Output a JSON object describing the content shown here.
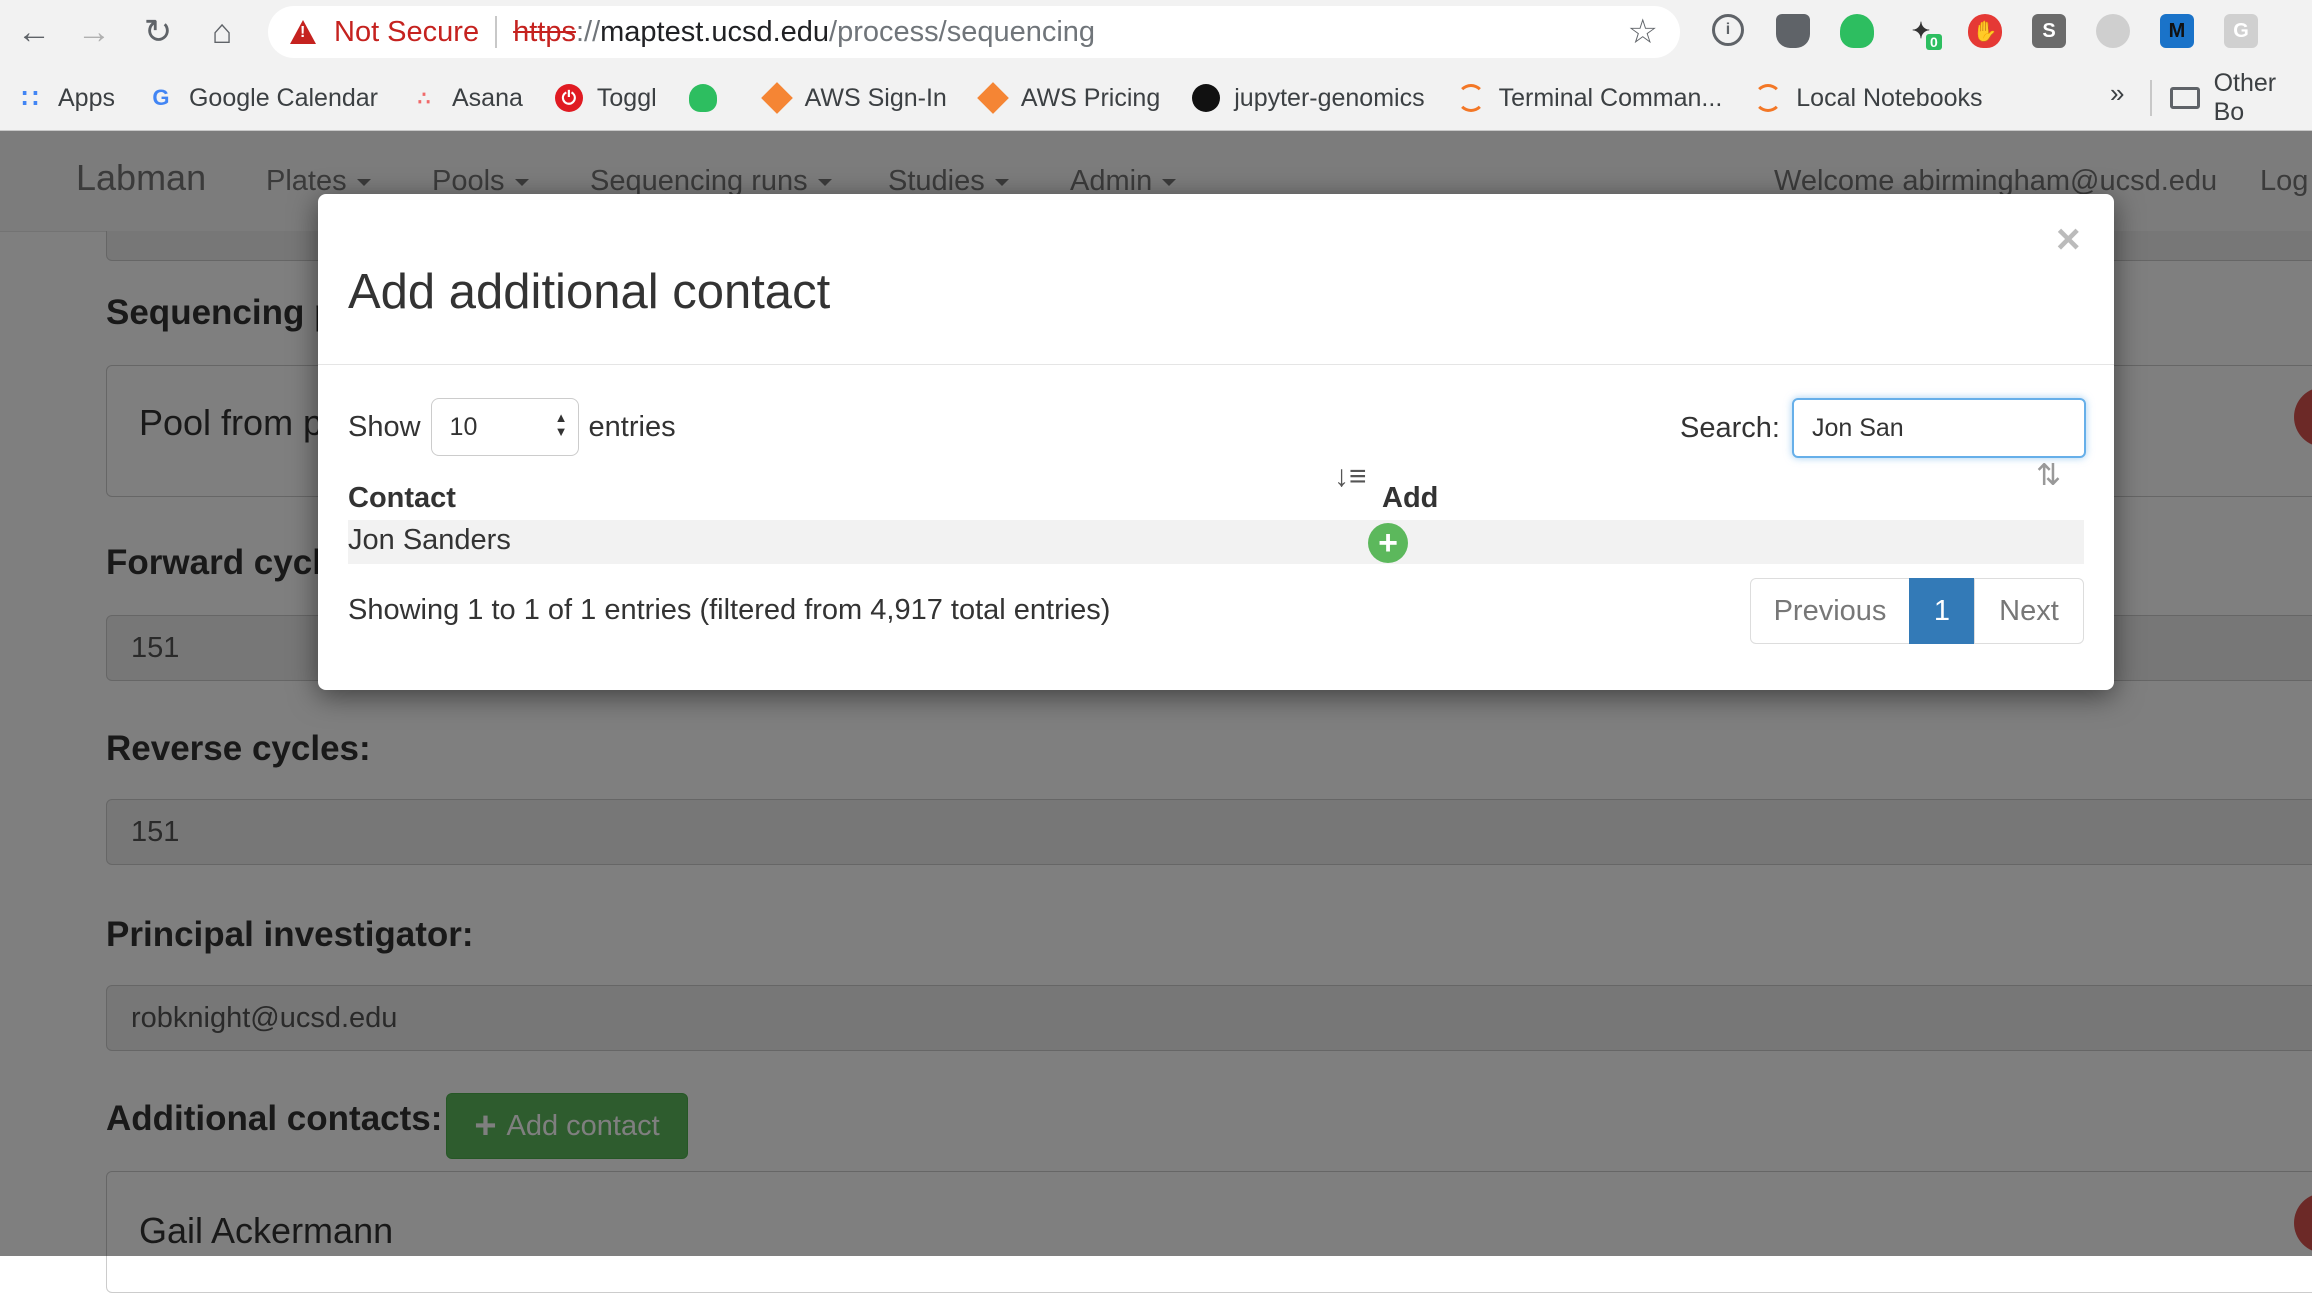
{
  "browser": {
    "security_label": "Not Secure",
    "url_scheme": "https",
    "url_sep": "://",
    "url_host": "maptest.ucsd.edu",
    "url_path": "/process/sequencing",
    "bookmarks": [
      {
        "label": "Apps",
        "icon": "apps-grid-icon"
      },
      {
        "label": "Google Calendar",
        "icon": "google-icon"
      },
      {
        "label": "Asana",
        "icon": "asana-icon"
      },
      {
        "label": "Toggl",
        "icon": "toggl-icon"
      },
      {
        "label": "",
        "icon": "evernote-icon"
      },
      {
        "label": "AWS Sign-In",
        "icon": "aws-cube-icon"
      },
      {
        "label": "AWS Pricing",
        "icon": "aws-cube-icon"
      },
      {
        "label": "jupyter-genomics",
        "icon": "github-icon"
      },
      {
        "label": "Terminal Comman...",
        "icon": "jupyter-icon"
      },
      {
        "label": "Local Notebooks",
        "icon": "jupyter-icon"
      }
    ],
    "bookmarks_more": "»",
    "other_bookmarks": "Other Bo",
    "extension_badge": "0",
    "extension_m": "M",
    "extension_s": "S",
    "extension_g": "G"
  },
  "navbar": {
    "brand": "Labman",
    "items": [
      "Plates",
      "Pools",
      "Sequencing runs",
      "Studies",
      "Admin"
    ],
    "welcome": "Welcome abirmingham@ucsd.edu",
    "logout": "Log"
  },
  "form": {
    "sequencing_label": "Sequencing p",
    "pool_title": "Pool from p",
    "forward_label": "Forward cycl",
    "forward_value": "151",
    "reverse_label": "Reverse cycles:",
    "reverse_value": "151",
    "pi_label": "Principal investigator:",
    "pi_value": "robknight@ucsd.edu",
    "additional_label": "Additional contacts:",
    "add_contact_button": "Add contact",
    "contacts": [
      "Gail Ackermann"
    ]
  },
  "modal": {
    "title": "Add additional contact",
    "close": "×",
    "show_label": "Show",
    "length_value": "10",
    "entries_label": "entries",
    "search_label": "Search:",
    "search_value": "Jon San",
    "columns": [
      "Contact",
      "Add"
    ],
    "rows": [
      {
        "contact": "Jon Sanders"
      }
    ],
    "info": "Showing 1 to 1 of 1 entries (filtered from 4,917 total entries)",
    "pagination": {
      "previous": "Previous",
      "current": "1",
      "next": "Next"
    }
  }
}
